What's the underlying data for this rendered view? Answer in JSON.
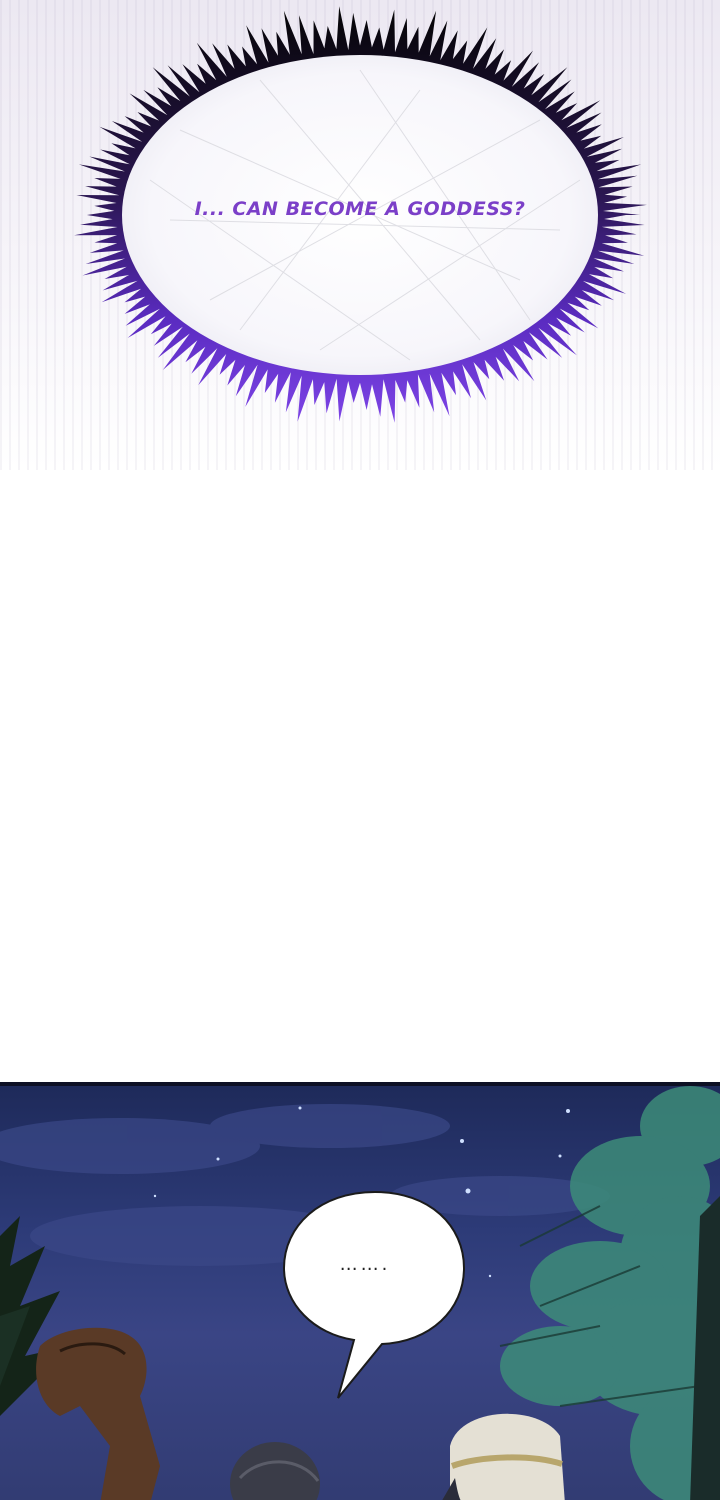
{
  "panel_top": {
    "thought_text": "I... CAN BECOME A GODDESS?",
    "colors": {
      "bubble_ring_top": "#0a0a0a",
      "bubble_ring_bottom": "#6d33d6",
      "text": "#7b3fc8"
    }
  },
  "panel_bottom": {
    "speech_text": "…….",
    "colors": {
      "sky": "#2d3b78",
      "foliage": "#3f8f7a",
      "hat": "#e4e0d4"
    }
  }
}
